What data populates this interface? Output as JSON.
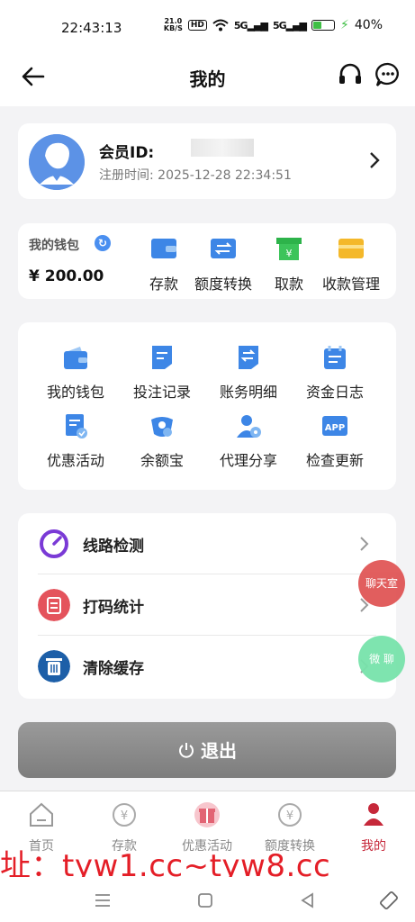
{
  "status": {
    "time": "22:43:13",
    "speed_num": "21.0",
    "speed_unit": "KB/S",
    "hd": "HD",
    "net1": "5G",
    "net2": "5G",
    "battery": "40%"
  },
  "nav": {
    "title": "我的"
  },
  "profile": {
    "id_label": "会员ID:",
    "reg_time": "注册时间: 2025-12-28 22:34:51"
  },
  "wallet": {
    "label": "我的钱包",
    "amount": "¥ 200.00",
    "actions": [
      {
        "label": "存款"
      },
      {
        "label": "额度转换"
      },
      {
        "label": "取款"
      },
      {
        "label": "收款管理"
      }
    ]
  },
  "grid": {
    "items": [
      {
        "label": "我的钱包"
      },
      {
        "label": "投注记录"
      },
      {
        "label": "账务明细"
      },
      {
        "label": "资金日志"
      },
      {
        "label": "优惠活动"
      },
      {
        "label": "余额宝"
      },
      {
        "label": "代理分享"
      },
      {
        "label": "检查更新",
        "icon_text": "APP"
      }
    ]
  },
  "list": {
    "items": [
      {
        "label": "线路检测"
      },
      {
        "label": "打码统计"
      },
      {
        "label": "清除缓存"
      }
    ]
  },
  "logout": {
    "label": "退出"
  },
  "floats": {
    "chat": "聊天室",
    "wechat": "微 聊"
  },
  "tabs": [
    {
      "label": "首页"
    },
    {
      "label": "存款"
    },
    {
      "label": "优惠活动"
    },
    {
      "label": "额度转换"
    },
    {
      "label": "我的"
    }
  ],
  "watermark": "址：tyw1.cc~tyw8.cc",
  "colors": {
    "accent": "#c6283a",
    "blue": "#3d86e6",
    "green": "#2db34a",
    "yellow": "#f4b82a"
  }
}
